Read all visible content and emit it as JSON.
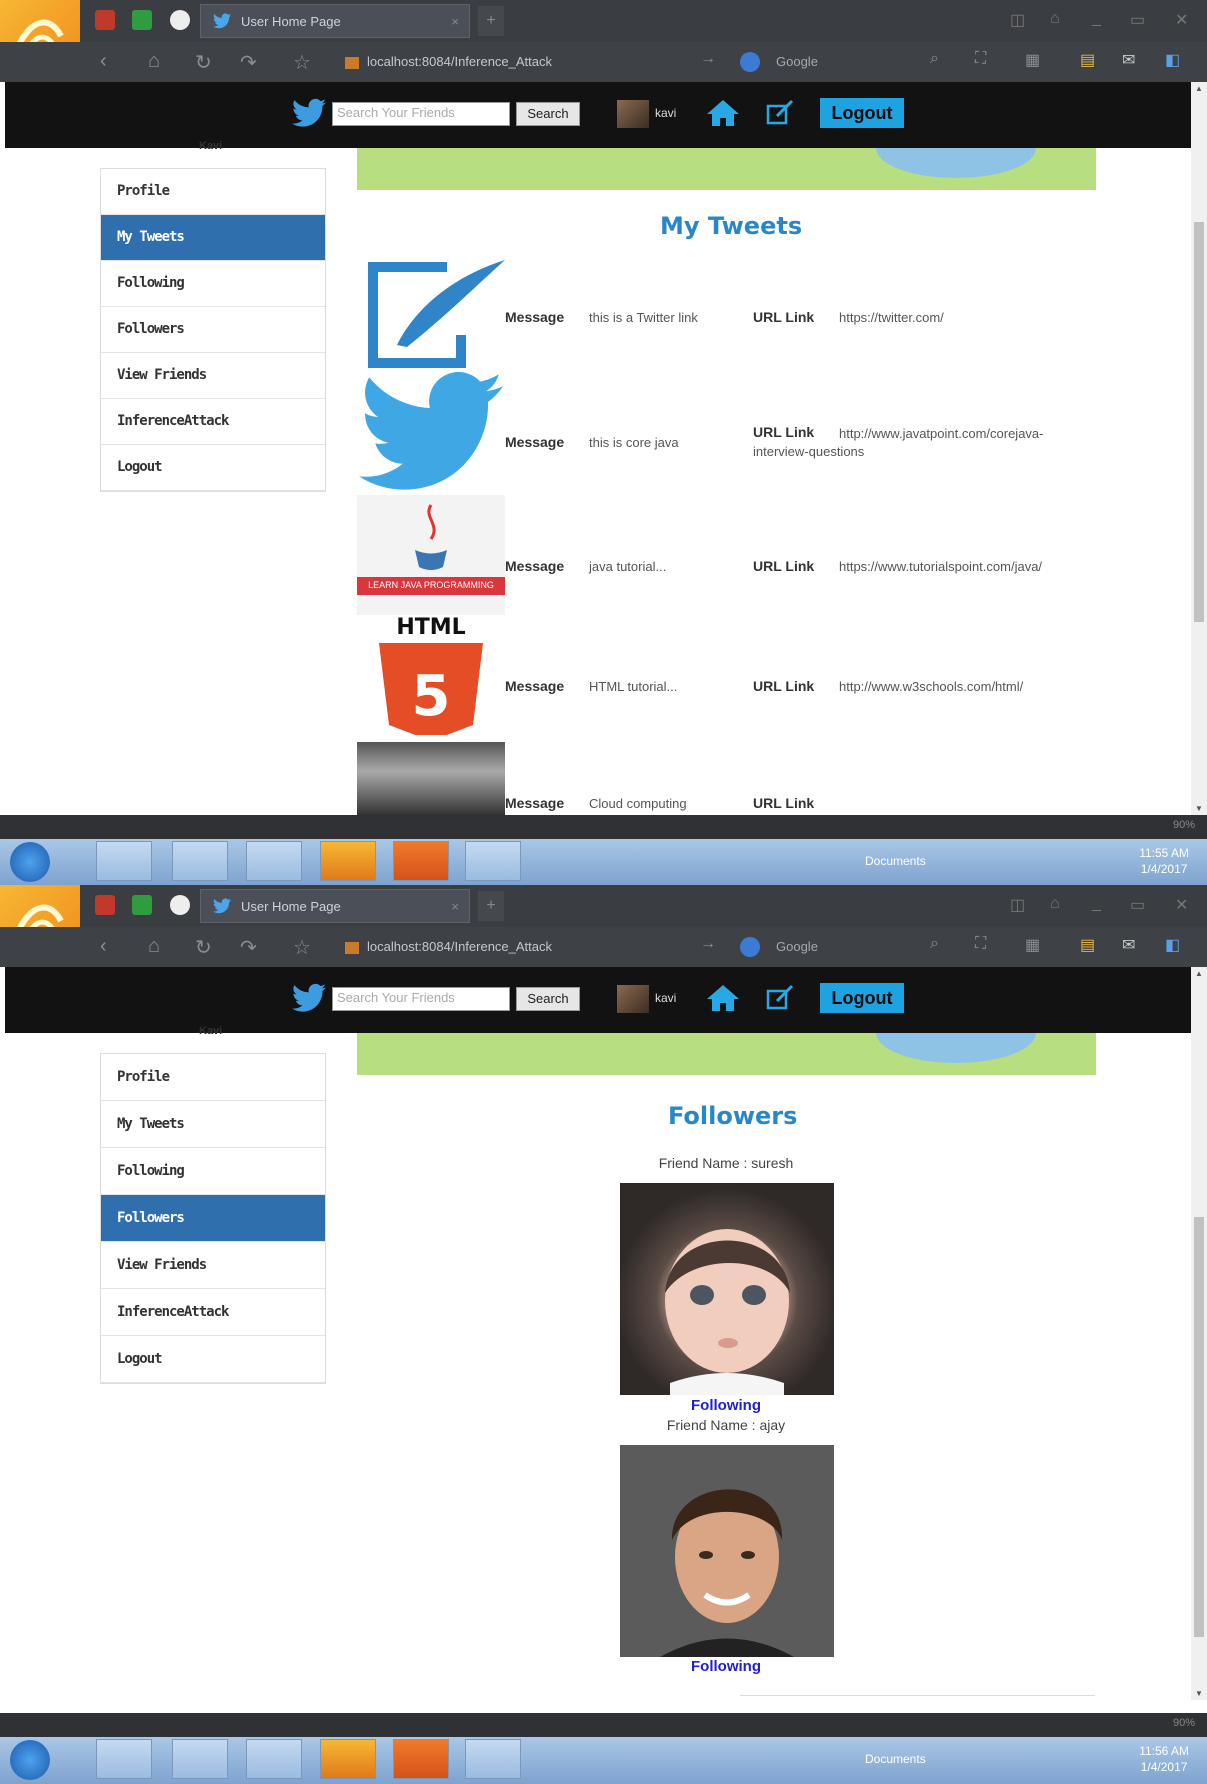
{
  "browser": {
    "tab_title": "User Home Page",
    "url": "localhost:8084/Inference_Attack",
    "search_engine": "Google"
  },
  "header": {
    "search_placeholder": "Search Your Friends",
    "search_button": "Search",
    "username": "kavi",
    "logout": "Logout"
  },
  "sidebar_top_text": "Kavi",
  "sidebar": {
    "items": [
      "Profile",
      "My Tweets",
      "Following",
      "Followers",
      "View Friends",
      "InferenceAttack",
      "Logout"
    ]
  },
  "page1": {
    "active_item": "My Tweets",
    "title": "My Tweets",
    "message_label": "Message",
    "url_label": "URL Link",
    "tweets": [
      {
        "image": "edit-feather-icon",
        "message": "this is a Twitter link",
        "url": "https://twitter.com/"
      },
      {
        "image": "twitter-bird-icon",
        "message": "this is core java",
        "url": "http://www.javatpoint.com/corejava-interview-questions"
      },
      {
        "image": "java-logo-thumbnail",
        "message": "java tutorial...",
        "url": "https://www.tutorialspoint.com/java/",
        "thumbnail_caption": "LEARN JAVA PROGRAMMING"
      },
      {
        "image": "html5-logo-thumbnail",
        "message": "HTML tutorial...",
        "url": "http://www.w3schools.com/html/",
        "thumbnail_caption": "HTML"
      },
      {
        "image": "cloud-computing-thumbnail",
        "message": "Cloud computing",
        "url": ""
      }
    ],
    "time": "11:55 AM",
    "date": "1/4/2017"
  },
  "page2": {
    "active_item": "Followers",
    "title": "Followers",
    "followers": [
      {
        "name_label": "Friend Name : suresh",
        "link": "Following",
        "photo": "child-portrait-photo"
      },
      {
        "name_label": "Friend Name : ajay",
        "link": "Following",
        "photo": "man-portrait-photo"
      }
    ],
    "time": "11:56 AM",
    "date": "1/4/2017"
  },
  "taskbar": {
    "documents_label": "Documents",
    "zoom": "90%"
  },
  "colors": {
    "accent_blue": "#2f6fae",
    "heading_blue": "#2a87c7",
    "logout_bg": "#1fa2e0",
    "link_blue": "#2121c8"
  }
}
